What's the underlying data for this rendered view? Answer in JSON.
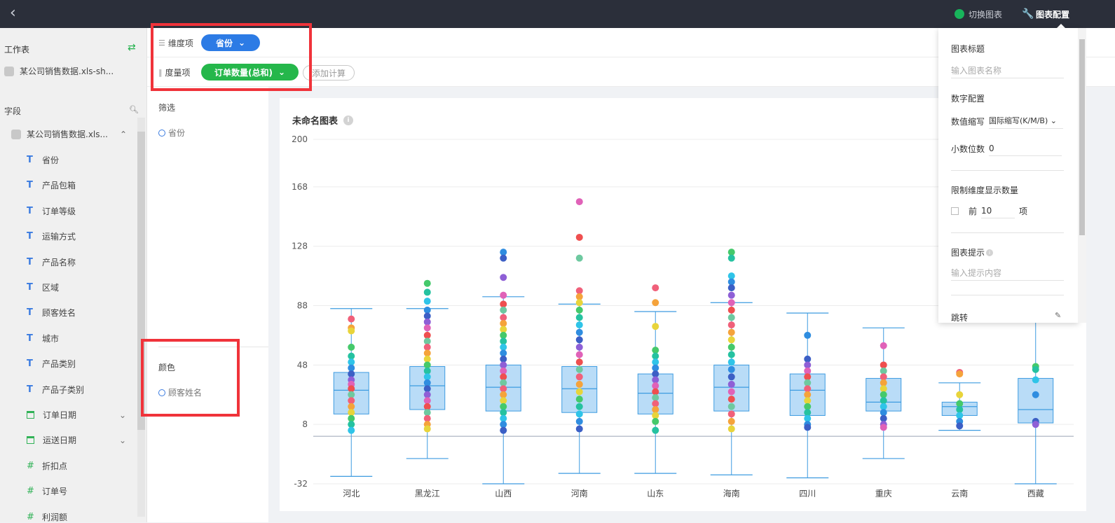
{
  "topbar": {
    "back_icon": "chevron-left-icon",
    "switch_chart_label": "切换图表",
    "chart_config_label": "图表配置"
  },
  "left": {
    "worksheet_title": "工作表",
    "dataset_name": "某公司销售数据.xls-sh...",
    "fields_title": "字段",
    "tree_root": "某公司销售数据.xls...",
    "fields": [
      {
        "type": "text",
        "label": "省份"
      },
      {
        "type": "text",
        "label": "产品包箱"
      },
      {
        "type": "text",
        "label": "订单等级"
      },
      {
        "type": "text",
        "label": "运输方式"
      },
      {
        "type": "text",
        "label": "产品名称"
      },
      {
        "type": "text",
        "label": "区域"
      },
      {
        "type": "text",
        "label": "顾客姓名"
      },
      {
        "type": "text",
        "label": "城市"
      },
      {
        "type": "text",
        "label": "产品类别"
      },
      {
        "type": "text",
        "label": "产品子类别"
      },
      {
        "type": "date",
        "label": "订单日期"
      },
      {
        "type": "date",
        "label": "运送日期"
      },
      {
        "type": "number",
        "label": "折扣点"
      },
      {
        "type": "number",
        "label": "订单号"
      },
      {
        "type": "number",
        "label": "利润额"
      }
    ]
  },
  "shelf": {
    "dimension_label": "维度项",
    "dimension_pill": "省份",
    "measure_label": "度量项",
    "measure_pill": "订单数量(总和)",
    "add_calc": "添加计算"
  },
  "mid": {
    "filter_title": "筛选",
    "filter_item": "省份",
    "color_title": "颜色",
    "color_item": "顾客姓名"
  },
  "config": {
    "title_section": "图表标题",
    "title_placeholder": "输入图表名称",
    "number_section": "数字配置",
    "abbr_label": "数值缩写",
    "abbr_value": "国际缩写(K/M/B)",
    "decimal_label": "小数位数",
    "decimal_value": "0",
    "limit_section": "限制维度显示数量",
    "limit_prefix": "前",
    "limit_value": "10",
    "limit_suffix": "项",
    "tip_section": "图表提示",
    "tip_placeholder": "输入提示内容",
    "jump_section": "跳转"
  },
  "chart_data": {
    "type": "boxplot",
    "title": "未命名图表",
    "y_ticks": [
      200,
      168,
      128,
      88,
      48,
      8,
      -32
    ],
    "ylim": [
      -32,
      200
    ],
    "categories": [
      "河北",
      "黑龙江",
      "山西",
      "河南",
      "山东",
      "海南",
      "四川",
      "重庆",
      "云南",
      "西藏"
    ],
    "boxes": [
      {
        "min": -27,
        "q1": 15,
        "median": 31,
        "q3": 43,
        "max": 86,
        "outliers": [
          79,
          73,
          71,
          60,
          54,
          50,
          46,
          42,
          38,
          35,
          32,
          28,
          24,
          20,
          16,
          12,
          8,
          4
        ]
      },
      {
        "min": -15,
        "q1": 18,
        "median": 34,
        "q3": 47,
        "max": 86,
        "outliers": [
          103,
          97,
          91,
          85,
          81,
          77,
          73,
          68,
          64,
          60,
          56,
          52,
          48,
          44,
          40,
          36,
          32,
          28,
          24,
          20,
          16,
          12,
          8,
          5
        ]
      },
      {
        "min": -32,
        "q1": 17,
        "median": 33,
        "q3": 48,
        "max": 94,
        "outliers": [
          124,
          120,
          107,
          95,
          89,
          85,
          80,
          76,
          72,
          68,
          64,
          60,
          56,
          52,
          48,
          44,
          40,
          36,
          32,
          28,
          24,
          20,
          16,
          12,
          8,
          4
        ]
      },
      {
        "min": -25,
        "q1": 16,
        "median": 32,
        "q3": 47,
        "max": 89,
        "outliers": [
          158,
          134,
          120,
          98,
          94,
          90,
          85,
          80,
          75,
          70,
          65,
          60,
          55,
          50,
          45,
          40,
          35,
          30,
          25,
          20,
          15,
          10,
          5
        ]
      },
      {
        "min": -25,
        "q1": 15,
        "median": 29,
        "q3": 42,
        "max": 84,
        "outliers": [
          100,
          90,
          74,
          58,
          54,
          50,
          46,
          42,
          38,
          34,
          30,
          26,
          22,
          18,
          14,
          10,
          4
        ]
      },
      {
        "min": -26,
        "q1": 17,
        "median": 33,
        "q3": 48,
        "max": 90,
        "outliers": [
          124,
          120,
          108,
          104,
          100,
          95,
          90,
          85,
          80,
          75,
          70,
          65,
          60,
          55,
          50,
          45,
          40,
          35,
          30,
          25,
          20,
          15,
          10,
          5
        ]
      },
      {
        "min": -28,
        "q1": 14,
        "median": 31,
        "q3": 42,
        "max": 83,
        "outliers": [
          68,
          52,
          48,
          44,
          40,
          36,
          32,
          28,
          24,
          20,
          16,
          12,
          8,
          6
        ]
      },
      {
        "min": -15,
        "q1": 17,
        "median": 23,
        "q3": 39,
        "max": 73,
        "outliers": [
          61,
          48,
          44,
          40,
          36,
          32,
          28,
          24,
          20,
          16,
          12,
          8,
          6
        ]
      },
      {
        "min": 4,
        "q1": 14,
        "median": 20,
        "q3": 23,
        "max": 36,
        "outliers": [
          43,
          42,
          28,
          22,
          18,
          14,
          10,
          7
        ]
      },
      {
        "min": -32,
        "q1": 9,
        "median": 18,
        "q3": 39,
        "max": 80,
        "outliers": [
          47,
          45,
          38,
          28,
          10,
          8
        ]
      }
    ]
  },
  "colors": {
    "box_fill": "#b9dcf7",
    "box_stroke": "#3d9be0",
    "accent_blue": "#2c7be5",
    "accent_green": "#25b74b",
    "highlight_red": "#f0333a",
    "dot_palette": [
      "#f0607a",
      "#f5a33b",
      "#e8d43b",
      "#45c96b",
      "#25c2a0",
      "#2fc4e8",
      "#2f8de0",
      "#3c5fc5",
      "#8e5fd6",
      "#e062b8",
      "#ef4f4f",
      "#6ec9a0"
    ]
  }
}
